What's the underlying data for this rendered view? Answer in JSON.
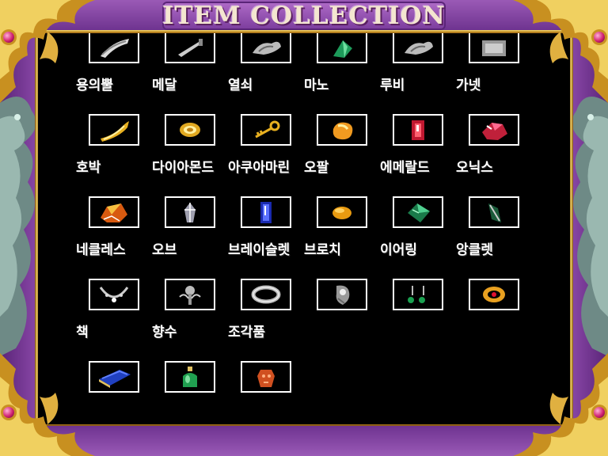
{
  "title": "ITEM COLLECTION",
  "rows": [
    [
      {
        "name": "",
        "icon": "horn-icon"
      },
      {
        "name": "",
        "icon": "dagger-icon"
      },
      {
        "name": "",
        "icon": "claw-icon"
      },
      {
        "name": "",
        "icon": "emerald-shard-icon"
      },
      {
        "name": "",
        "icon": "claw-icon"
      },
      {
        "name": "",
        "icon": "silver-item-icon"
      }
    ],
    [
      {
        "name": "용의뿔",
        "icon": "dragon-horn-icon"
      },
      {
        "name": "메달",
        "icon": "medal-icon"
      },
      {
        "name": "열쇠",
        "icon": "key-icon"
      },
      {
        "name": "마노",
        "icon": "agate-icon"
      },
      {
        "name": "루비",
        "icon": "ruby-icon"
      },
      {
        "name": "가넷",
        "icon": "garnet-icon"
      }
    ],
    [
      {
        "name": "호박",
        "icon": "amber-icon"
      },
      {
        "name": "다이아몬드",
        "icon": "diamond-icon"
      },
      {
        "name": "아쿠아마린",
        "icon": "aquamarine-icon"
      },
      {
        "name": "오팔",
        "icon": "opal-icon"
      },
      {
        "name": "에메랄드",
        "icon": "emerald-icon"
      },
      {
        "name": "오닉스",
        "icon": "onyx-icon"
      }
    ],
    [
      {
        "name": "네클레스",
        "icon": "necklace-icon"
      },
      {
        "name": "오브",
        "icon": "orb-icon"
      },
      {
        "name": "브레이슬렛",
        "icon": "bracelet-icon"
      },
      {
        "name": "브로치",
        "icon": "brooch-icon"
      },
      {
        "name": "이어링",
        "icon": "earring-icon"
      },
      {
        "name": "앙클렛",
        "icon": "anklet-icon"
      }
    ],
    [
      {
        "name": "책",
        "icon": "book-icon"
      },
      {
        "name": "향수",
        "icon": "perfume-icon"
      },
      {
        "name": "조각품",
        "icon": "sculpture-icon"
      }
    ]
  ]
}
